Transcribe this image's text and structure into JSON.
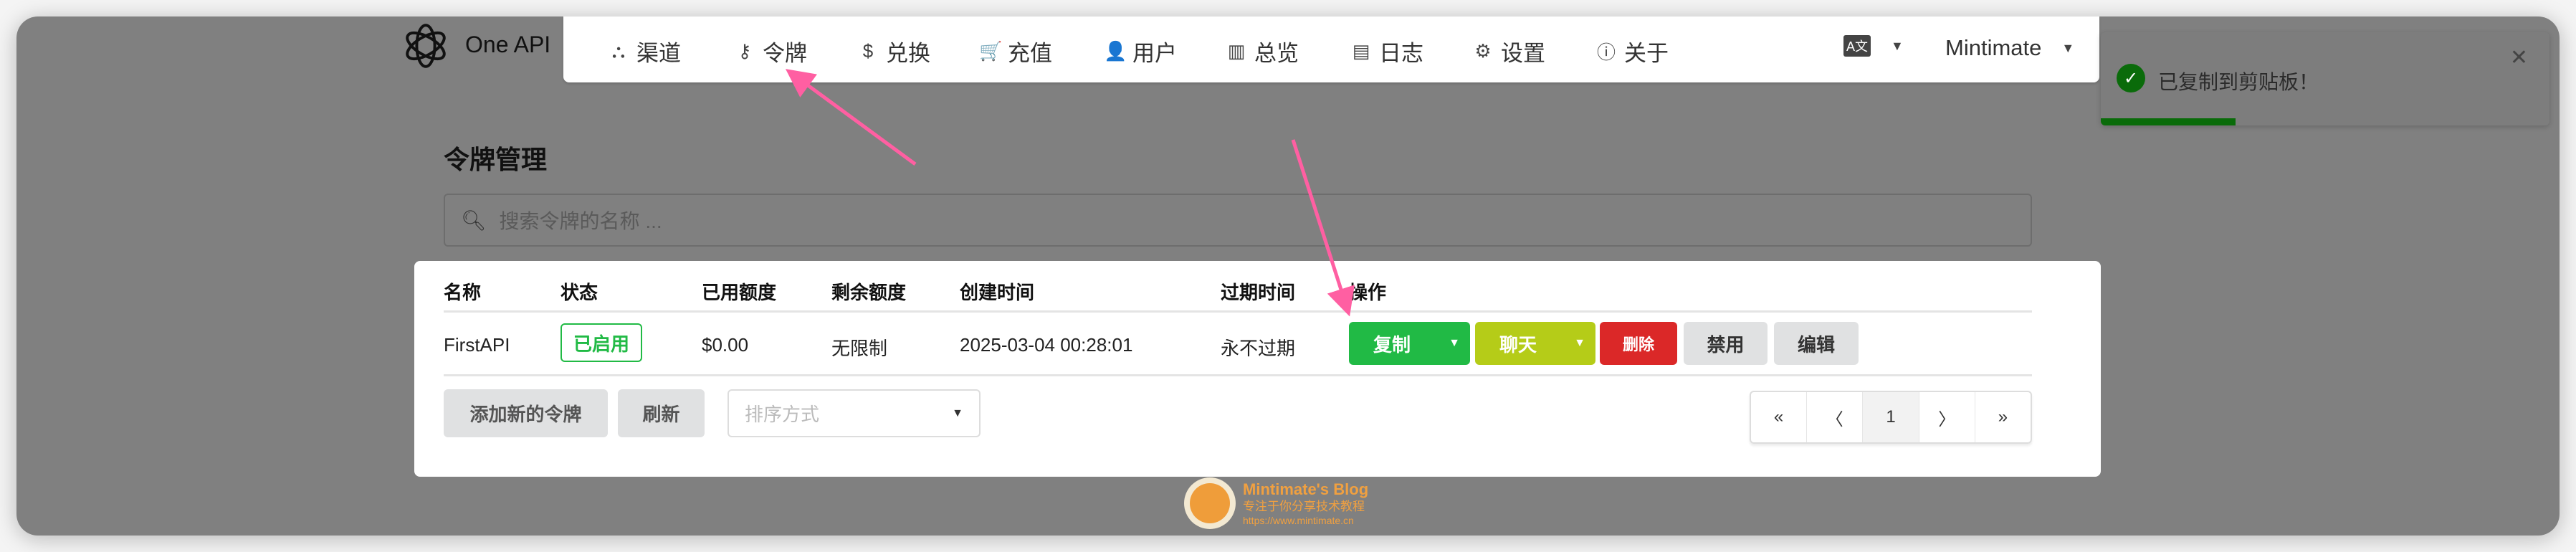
{
  "brand": "One API",
  "nav": [
    {
      "icon": "sitemap-icon",
      "glyph": "⛬",
      "label": "渠道"
    },
    {
      "icon": "key-icon",
      "glyph": "⚷",
      "label": "令牌"
    },
    {
      "icon": "dollar-icon",
      "glyph": "$",
      "label": "兑换"
    },
    {
      "icon": "cart-icon",
      "glyph": "🛒",
      "label": "充值"
    },
    {
      "icon": "user-icon",
      "glyph": "👤",
      "label": "用户"
    },
    {
      "icon": "chart-icon",
      "glyph": "▥",
      "label": "总览"
    },
    {
      "icon": "book-icon",
      "glyph": "▤",
      "label": "日志"
    },
    {
      "icon": "gear-icon",
      "glyph": "⚙",
      "label": "设置"
    },
    {
      "icon": "info-icon",
      "glyph": "ⓘ",
      "label": "关于"
    }
  ],
  "language_glyph": "A文",
  "user": "Mintimate",
  "page_title": "令牌管理",
  "search_placeholder": "搜索令牌的名称 ...",
  "table": {
    "headers": [
      "名称",
      "状态",
      "已用额度",
      "剩余额度",
      "创建时间",
      "过期时间",
      "操作"
    ],
    "rows": [
      {
        "name": "FirstAPI",
        "status": "已启用",
        "used": "$0.00",
        "remaining": "无限制",
        "created": "2025-03-04 00:28:01",
        "expires": "永不过期"
      }
    ],
    "actions": {
      "copy": "复制",
      "chat": "聊天",
      "delete": "删除",
      "disable": "禁用",
      "edit": "编辑"
    }
  },
  "footer": {
    "add": "添加新的令牌",
    "refresh": "刷新",
    "sort_placeholder": "排序方式"
  },
  "pagination": {
    "first": "«",
    "prev": "〈",
    "current": "1",
    "next": "〉",
    "last": "»"
  },
  "toast": {
    "message": "已复制到剪贴板！",
    "progress": 0.3
  },
  "watermark": {
    "title": "Mintimate's Blog",
    "subtitle": "专注于你分享技术教程",
    "url": "https://www.mintimate.cn"
  },
  "colors": {
    "green": "#21ba45",
    "olive": "#b5cc18",
    "red": "#db2828",
    "arrow": "#ff5fa2"
  }
}
